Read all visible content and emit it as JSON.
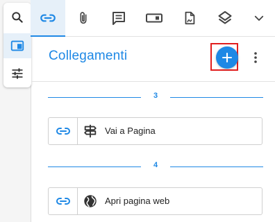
{
  "colors": {
    "accent": "#1e88e5",
    "highlight_border": "#e11d1d",
    "icon_gray": "#444444"
  },
  "left_toolbar": {
    "items": [
      {
        "icon": "search-icon",
        "active": false
      },
      {
        "icon": "panel-icon",
        "active": true
      },
      {
        "icon": "sliders-icon",
        "active": false
      }
    ]
  },
  "tabs": [
    {
      "icon": "link-icon",
      "active": true
    },
    {
      "icon": "paperclip-icon",
      "active": false
    },
    {
      "icon": "comment-icon",
      "active": false
    },
    {
      "icon": "form-field-icon",
      "active": false
    },
    {
      "icon": "signature-icon",
      "active": false
    },
    {
      "icon": "layers-icon",
      "active": false
    },
    {
      "icon": "chevron-down-icon",
      "active": false
    }
  ],
  "panel": {
    "title": "Collegamenti",
    "add_icon": "plus-icon",
    "more_icon": "more-vertical-icon"
  },
  "link_groups": [
    {
      "page": "3",
      "items": [
        {
          "icon": "link-icon",
          "action_icon": "signpost-icon",
          "label": "Vai a Pagina"
        }
      ]
    },
    {
      "page": "4",
      "items": [
        {
          "icon": "link-icon",
          "action_icon": "globe-icon",
          "label": "Apri pagina web"
        }
      ]
    }
  ]
}
